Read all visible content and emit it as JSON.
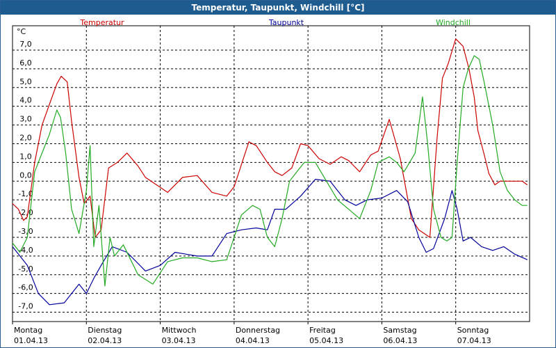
{
  "window": {
    "title": "Temperatur, Taupunkt, Windchill [°C]"
  },
  "chart_data": {
    "type": "line",
    "title": "Temperatur, Taupunkt, Windchill [°C]",
    "ylabel": "°C",
    "ylim": [
      -7.5,
      8.3
    ],
    "xlim": [
      0,
      7
    ],
    "grid": true,
    "yticks": [
      -7,
      -6,
      -5,
      -4,
      -3,
      -2,
      -1,
      0,
      1,
      2,
      3,
      4,
      5,
      6,
      7
    ],
    "ytick_labels": [
      "-7,0",
      "-6,0",
      "-5,0",
      "-4,0",
      "-3,0",
      "-2,0",
      "-1,0",
      "0,0",
      "1,0",
      "2,0",
      "3,0",
      "4,0",
      "5,0",
      "6,0",
      "7,0"
    ],
    "categories": [
      {
        "day": "Montag",
        "date": "01.04.13"
      },
      {
        "day": "Dienstag",
        "date": "02.04.13"
      },
      {
        "day": "Mittwoch",
        "date": "03.04.13"
      },
      {
        "day": "Donnerstag",
        "date": "04.04.13"
      },
      {
        "day": "Freitag",
        "date": "05.04.13"
      },
      {
        "day": "Samstag",
        "date": "06.04.13"
      },
      {
        "day": "Sonntag",
        "date": "07.04.13"
      }
    ],
    "series": [
      {
        "name": "Temperatur",
        "color": "#cc0000",
        "x": [
          0,
          0.08,
          0.15,
          0.2,
          0.3,
          0.4,
          0.5,
          0.6,
          0.66,
          0.74,
          0.8,
          0.9,
          0.97,
          1.05,
          1.12,
          1.2,
          1.3,
          1.42,
          1.55,
          1.7,
          1.8,
          1.95,
          2.1,
          2.3,
          2.5,
          2.7,
          2.9,
          3.0,
          3.2,
          3.3,
          3.45,
          3.55,
          3.65,
          3.78,
          3.9,
          4.0,
          4.15,
          4.3,
          4.45,
          4.55,
          4.7,
          4.85,
          4.95,
          5.1,
          5.25,
          5.4,
          5.5,
          5.65,
          5.75,
          5.82,
          5.9,
          6.0,
          6.1,
          6.18,
          6.25,
          6.3,
          6.38,
          6.45,
          6.53,
          6.6,
          6.68,
          6.75,
          6.82,
          6.9,
          6.97
        ],
        "y": [
          -1.2,
          -1.5,
          -2.1,
          -1.9,
          1.0,
          3.0,
          4.1,
          5.2,
          5.6,
          5.3,
          3.2,
          0.2,
          -1.2,
          -0.8,
          -3.0,
          -2.6,
          0.7,
          1.0,
          1.5,
          0.8,
          0.2,
          -0.2,
          -0.6,
          0.2,
          0.3,
          -0.6,
          -0.8,
          -0.3,
          2.1,
          1.9,
          1.0,
          0.5,
          0.3,
          0.7,
          2.0,
          1.9,
          1.2,
          0.9,
          1.3,
          1.1,
          0.5,
          1.4,
          1.6,
          3.3,
          1.2,
          -2.0,
          -2.6,
          -3.0,
          2.4,
          5.5,
          6.3,
          7.6,
          7.2,
          6.0,
          4.5,
          2.7,
          1.5,
          0.4,
          -0.2,
          0.0,
          0.0,
          0.0,
          0.0,
          0.0,
          -0.2
        ],
        "x_note": ""
      },
      {
        "name": "Taupunkt",
        "color": "#000099",
        "x": [
          0,
          0.2,
          0.35,
          0.5,
          0.7,
          0.9,
          1.0,
          1.1,
          1.2,
          1.35,
          1.55,
          1.8,
          2.0,
          2.2,
          2.35,
          2.5,
          2.7,
          2.9,
          3.1,
          3.3,
          3.45,
          3.55,
          3.7,
          3.9,
          4.1,
          4.3,
          4.5,
          4.65,
          4.8,
          5.0,
          5.2,
          5.35,
          5.5,
          5.6,
          5.7,
          5.85,
          5.95,
          6.02,
          6.1,
          6.2,
          6.35,
          6.5,
          6.65,
          6.8,
          6.97
        ],
        "y": [
          -3.5,
          -4.5,
          -6.0,
          -6.6,
          -6.5,
          -5.5,
          -6.0,
          -5.2,
          -4.5,
          -3.5,
          -3.8,
          -4.8,
          -4.5,
          -3.8,
          -3.9,
          -4.0,
          -4.0,
          -2.8,
          -2.6,
          -2.5,
          -2.6,
          -1.5,
          -1.5,
          -0.8,
          0.1,
          0.0,
          -1.0,
          -1.3,
          -1.0,
          -0.9,
          -0.5,
          -1.1,
          -3.0,
          -3.8,
          -3.6,
          -2.0,
          -0.5,
          -1.5,
          -3.2,
          -3.0,
          -3.5,
          -3.7,
          -3.5,
          -3.9,
          -4.2
        ],
        "x_note": ""
      },
      {
        "name": "Windchill",
        "color": "#22aa22",
        "x": [
          0,
          0.1,
          0.2,
          0.3,
          0.4,
          0.5,
          0.6,
          0.65,
          0.72,
          0.8,
          0.9,
          1.0,
          1.05,
          1.1,
          1.17,
          1.25,
          1.32,
          1.38,
          1.5,
          1.7,
          1.9,
          2.1,
          2.3,
          2.5,
          2.7,
          2.9,
          3.1,
          3.25,
          3.35,
          3.45,
          3.55,
          3.65,
          3.75,
          3.85,
          3.95,
          4.1,
          4.25,
          4.4,
          4.55,
          4.7,
          4.85,
          4.95,
          5.1,
          5.2,
          5.3,
          5.45,
          5.55,
          5.62,
          5.7,
          5.8,
          5.88,
          5.95,
          6.02,
          6.1,
          6.17,
          6.25,
          6.32,
          6.4,
          6.5,
          6.6,
          6.7,
          6.8,
          6.9,
          6.97
        ],
        "y": [
          -3.3,
          -3.8,
          -3.0,
          0.5,
          1.5,
          2.5,
          3.8,
          3.4,
          1.5,
          -1.5,
          -2.8,
          -0.5,
          1.9,
          -3.5,
          -1.3,
          -5.6,
          -3.0,
          -4.0,
          -3.4,
          -5.0,
          -5.5,
          -4.3,
          -4.1,
          -4.1,
          -4.3,
          -4.2,
          -1.8,
          -1.3,
          -1.5,
          -3.0,
          -3.5,
          -2.0,
          0.0,
          0.5,
          1.0,
          1.0,
          0.0,
          -1.0,
          -1.5,
          -2.0,
          -0.5,
          1.0,
          1.3,
          1.0,
          0.5,
          1.5,
          4.5,
          2.0,
          -1.5,
          -3.0,
          -3.2,
          -3.0,
          1.0,
          5.0,
          6.0,
          6.7,
          6.5,
          5.0,
          3.0,
          0.5,
          -0.5,
          -1.0,
          -1.3,
          -1.3
        ],
        "x_note": ""
      }
    ]
  }
}
